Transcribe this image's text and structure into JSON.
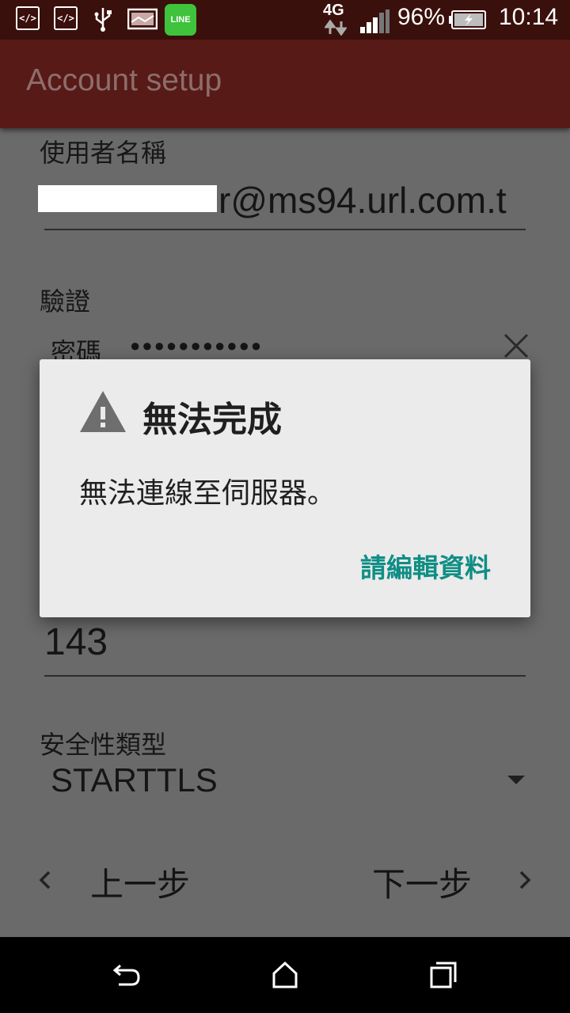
{
  "status_bar": {
    "icons": [
      "code-icon",
      "code-icon",
      "usb-icon",
      "image-icon",
      "line-app-icon"
    ],
    "line_label": "LINE",
    "network": "4G",
    "battery": "96%",
    "time": "10:14"
  },
  "app_bar": {
    "title": "Account setup"
  },
  "form": {
    "username_label": "使用者名稱",
    "username_value": "r@ms94.url.com.t",
    "auth_label": "驗證",
    "password_label": "密碼",
    "password_value": "●●●●●●●●●●●",
    "port_value": "143",
    "security_label": "安全性類型",
    "security_value": "STARTTLS"
  },
  "nav": {
    "prev_label": "上一步",
    "next_label": "下一步"
  },
  "dialog": {
    "title": "無法完成",
    "message": "無法連線至伺服器。",
    "button": "請編輯資料"
  },
  "colors": {
    "status_bar": "#3a100c",
    "app_bar": "#571a16",
    "dialog_accent": "#0f8e85"
  }
}
